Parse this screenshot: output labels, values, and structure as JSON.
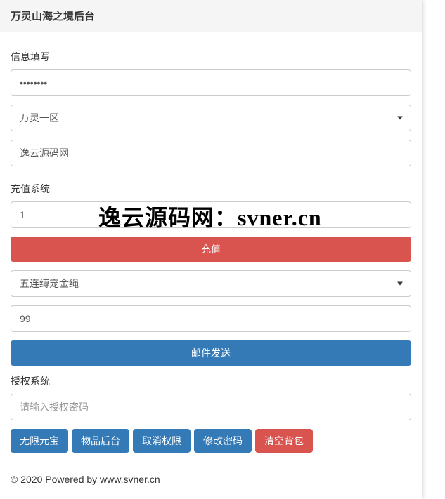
{
  "header": {
    "title": "万灵山海之境后台"
  },
  "section_info": {
    "label": "信息填写",
    "password_value": "••••••••",
    "server_select": "万灵一区",
    "source_value": "逸云源码网"
  },
  "section_recharge": {
    "label": "充值系统",
    "amount_value": "1",
    "recharge_button": "充值",
    "item_select": "五连缚宠金绳",
    "quantity_value": "99",
    "send_mail_button": "邮件发送"
  },
  "section_auth": {
    "label": "授权系统",
    "auth_placeholder": "请输入授权密码"
  },
  "buttons": {
    "unlimited_gold": "无限元宝",
    "item_backend": "物品后台",
    "cancel_perm": "取消权限",
    "change_pwd": "修改密码",
    "clear_bag": "清空背包"
  },
  "footer": {
    "text": "© 2020 Powered by www.svner.cn"
  },
  "watermark": {
    "text": "逸云源码网：svner.cn"
  }
}
